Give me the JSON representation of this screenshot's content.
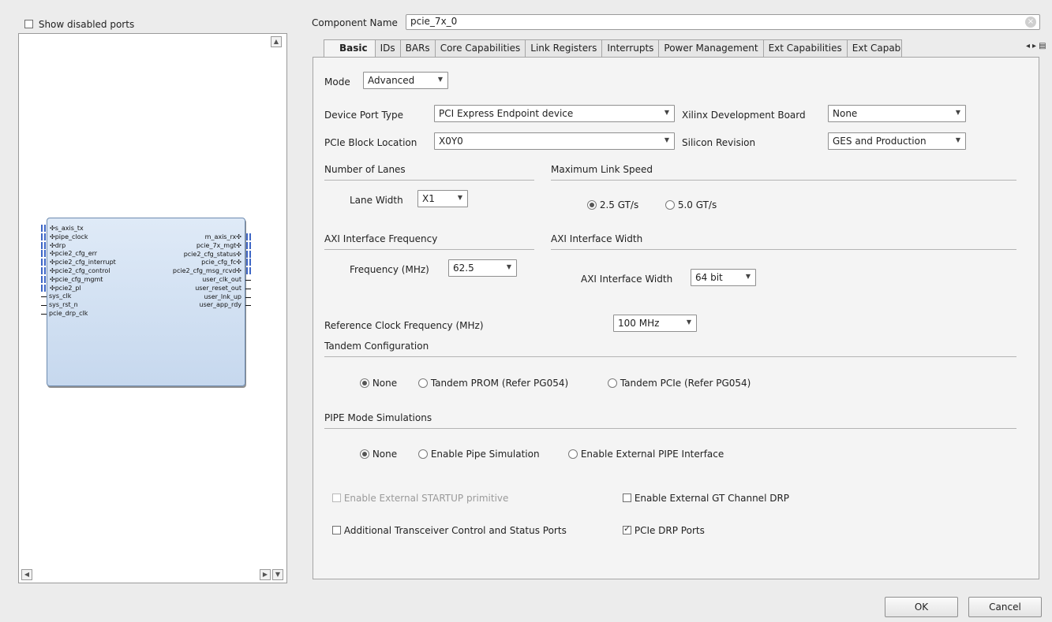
{
  "left": {
    "show_disabled_label": "Show disabled ports",
    "ports_left": [
      "s_axis_tx",
      "pipe_clock",
      "drp",
      "pcie2_cfg_err",
      "pcie2_cfg_interrupt",
      "pcie2_cfg_control",
      "pcie_cfg_mgmt",
      "pcie2_pl",
      "sys_clk",
      "sys_rst_n",
      "pcie_drp_clk"
    ],
    "ports_right": [
      "m_axis_rx",
      "pcie_7x_mgt",
      "pcie2_cfg_status",
      "pcie_cfg_fc",
      "pcie2_cfg_msg_rcvd",
      "user_clk_out",
      "user_reset_out",
      "user_lnk_up",
      "user_app_rdy"
    ]
  },
  "component": {
    "label": "Component Name",
    "value": "pcie_7x_0"
  },
  "tabs": [
    "Basic",
    "IDs",
    "BARs",
    "Core Capabilities",
    "Link Registers",
    "Interrupts",
    "Power Management",
    "Ext Capabilities",
    "Ext Capabili"
  ],
  "basic": {
    "mode_label": "Mode",
    "mode_value": "Advanced",
    "device_port_type_label": "Device Port Type",
    "device_port_type_value": "PCI Express Endpoint device",
    "board_label": "Xilinx Development Board",
    "board_value": "None",
    "block_location_label": "PCIe Block Location",
    "block_location_value": "X0Y0",
    "silicon_label": "Silicon Revision",
    "silicon_value": "GES and Production",
    "lanes_section": "Number of Lanes",
    "lane_width_label": "Lane Width",
    "lane_width_value": "X1",
    "speed_section": "Maximum Link Speed",
    "speed_opt1": "2.5 GT/s",
    "speed_opt2": "5.0 GT/s",
    "axi_freq_section": "AXI Interface Frequency",
    "freq_label": "Frequency (MHz)",
    "freq_value": "62.5",
    "axi_width_section": "AXI Interface Width",
    "axi_width_label": "AXI Interface Width",
    "axi_width_value": "64 bit",
    "ref_clk_label": "Reference Clock Frequency (MHz)",
    "ref_clk_value": "100 MHz",
    "tandem_section": "Tandem Configuration",
    "tandem_opt1": "None",
    "tandem_opt2": "Tandem PROM (Refer PG054)",
    "tandem_opt3": "Tandem PCIe (Refer PG054)",
    "pipe_section": "PIPE Mode Simulations",
    "pipe_opt1": "None",
    "pipe_opt2": "Enable Pipe Simulation",
    "pipe_opt3": "Enable External PIPE Interface",
    "startup_label": "Enable External STARTUP primitive",
    "gt_drp_label": "Enable External GT Channel DRP",
    "transceiver_label": "Additional Transceiver Control and Status Ports",
    "pcie_drp_label": "PCIe DRP Ports"
  },
  "buttons": {
    "ok": "OK",
    "cancel": "Cancel"
  }
}
